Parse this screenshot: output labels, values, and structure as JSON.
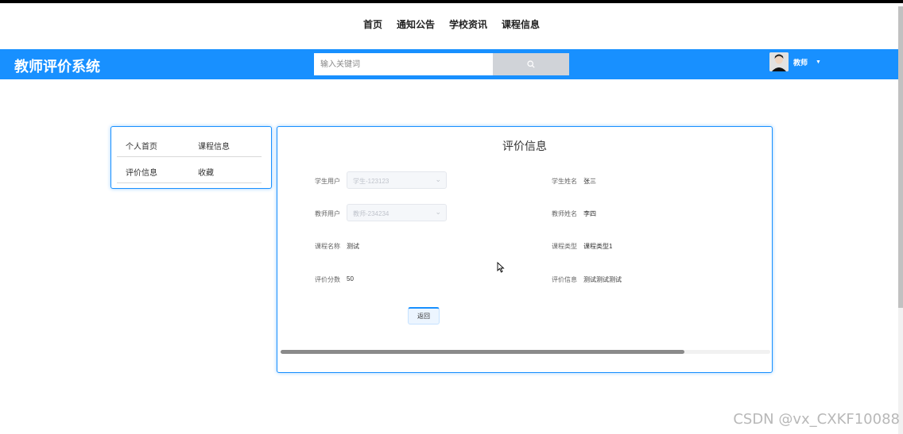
{
  "topnav": {
    "items": [
      "首页",
      "通知公告",
      "学校资讯",
      "课程信息"
    ]
  },
  "header": {
    "brand": "教师评价系统",
    "search_placeholder": "输入关键词",
    "search_icon": "search-icon",
    "user_name": "教师",
    "caret_icon": "caret-down-icon"
  },
  "sidebar": {
    "items": [
      "个人首页",
      "课程信息",
      "评价信息",
      "收藏"
    ]
  },
  "detail": {
    "title": "评价信息",
    "student_user_label": "学生用户",
    "student_user_value": "学生-123123",
    "student_name_label": "学生姓名",
    "student_name_value": "张三",
    "teacher_user_label": "教师用户",
    "teacher_user_value": "教师-234234",
    "teacher_name_label": "教师姓名",
    "teacher_name_value": "李四",
    "course_name_label": "课程名称",
    "course_name_value": "测试",
    "course_type_label": "课程类型",
    "course_type_value": "课程类型1",
    "score_label": "评价分数",
    "score_value": "50",
    "comment_label": "评价信息",
    "comment_value": "测试测试测试",
    "back_label": "返回"
  },
  "watermark": "CSDN @vx_CXKF10088",
  "colors": {
    "primary": "#1890ff",
    "search_button": "#d0d3d8"
  }
}
